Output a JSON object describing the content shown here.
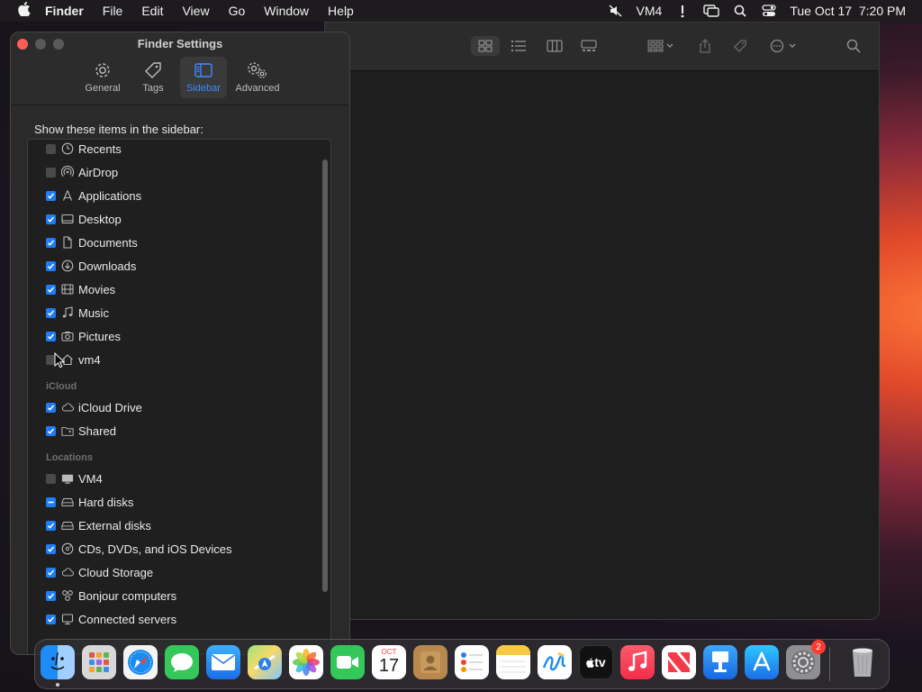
{
  "menubar": {
    "app": "Finder",
    "items": [
      "File",
      "Edit",
      "View",
      "Go",
      "Window",
      "Help"
    ],
    "user": "VM4",
    "datetime": "Tue Oct 17  7:20 PM"
  },
  "settings": {
    "title": "Finder Settings",
    "tabs": [
      "General",
      "Tags",
      "Sidebar",
      "Advanced"
    ],
    "active_tab": "Sidebar",
    "prompt": "Show these items in the sidebar:",
    "favorites": [
      {
        "label": "Recents",
        "state": "off",
        "icon": "clock-icon"
      },
      {
        "label": "AirDrop",
        "state": "off",
        "icon": "airdrop-icon"
      },
      {
        "label": "Applications",
        "state": "on",
        "icon": "applications-icon"
      },
      {
        "label": "Desktop",
        "state": "on",
        "icon": "desktop-icon"
      },
      {
        "label": "Documents",
        "state": "on",
        "icon": "document-icon"
      },
      {
        "label": "Downloads",
        "state": "on",
        "icon": "download-icon"
      },
      {
        "label": "Movies",
        "state": "on",
        "icon": "film-icon"
      },
      {
        "label": "Music",
        "state": "on",
        "icon": "music-note-icon"
      },
      {
        "label": "Pictures",
        "state": "on",
        "icon": "camera-icon"
      },
      {
        "label": "vm4",
        "state": "off",
        "icon": "home-icon"
      }
    ],
    "icloud_header": "iCloud",
    "icloud": [
      {
        "label": "iCloud Drive",
        "state": "on",
        "icon": "cloud-icon"
      },
      {
        "label": "Shared",
        "state": "on",
        "icon": "shared-folder-icon"
      }
    ],
    "locations_header": "Locations",
    "locations": [
      {
        "label": "VM4",
        "state": "off",
        "icon": "computer-icon"
      },
      {
        "label": "Hard disks",
        "state": "mixed",
        "icon": "hard-disk-icon"
      },
      {
        "label": "External disks",
        "state": "on",
        "icon": "external-disk-icon"
      },
      {
        "label": "CDs, DVDs, and iOS Devices",
        "state": "on",
        "icon": "disc-icon"
      },
      {
        "label": "Cloud Storage",
        "state": "on",
        "icon": "cloud-icon"
      },
      {
        "label": "Bonjour computers",
        "state": "on",
        "icon": "bonjour-icon"
      },
      {
        "label": "Connected servers",
        "state": "on",
        "icon": "server-icon"
      }
    ]
  },
  "dock": {
    "calendar_month": "OCT",
    "calendar_day": "17",
    "tv_label": "tv",
    "settings_badge": "2"
  },
  "colors": {
    "accent": "#1f7cf5",
    "close": "#ff5f57"
  }
}
